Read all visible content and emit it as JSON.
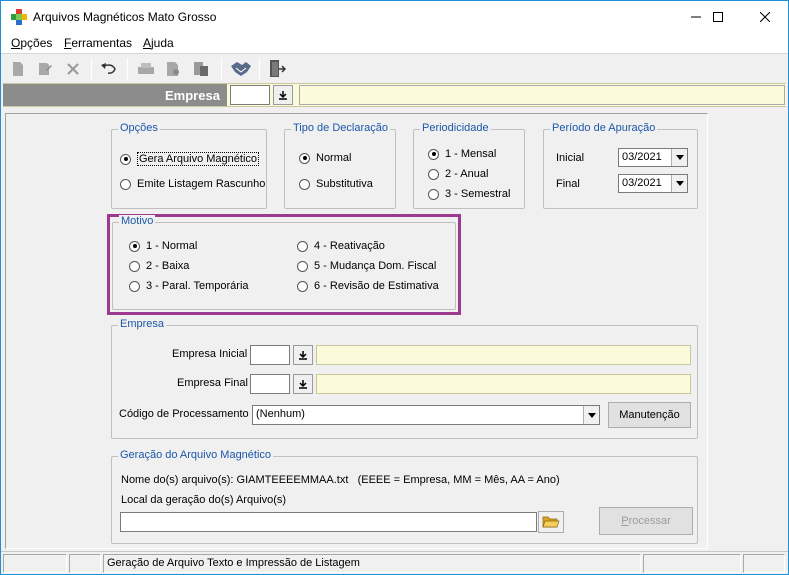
{
  "window": {
    "title": "Arquivos Magnéticos Mato Grosso",
    "controls": {
      "minimize": "–",
      "maximize": "☐",
      "close": "✕"
    }
  },
  "menu": {
    "items": [
      {
        "first": "O",
        "rest": "pções"
      },
      {
        "first": "F",
        "rest": "erramentas"
      },
      {
        "first": "A",
        "rest": "juda"
      }
    ]
  },
  "toolbar": {
    "icons": [
      "new-document-icon",
      "edit-document-icon",
      "delete-icon",
      "undo-icon",
      "print-icon",
      "print-preview-icon",
      "database-icon",
      "handshake-icon",
      "exit-door-icon"
    ]
  },
  "empresa_bar": {
    "label": "Empresa",
    "code_value": "",
    "name_value": ""
  },
  "opcoes": {
    "legend": "Opções",
    "options": [
      {
        "label": "Gera Arquivo Magnético",
        "selected": true
      },
      {
        "label": "Emite Listagem Rascunho",
        "selected": false
      }
    ]
  },
  "tipo_declaracao": {
    "legend": "Tipo de Declaração",
    "options": [
      {
        "label": "Normal",
        "selected": true
      },
      {
        "label": "Substitutiva",
        "selected": false
      }
    ]
  },
  "periodicidade": {
    "legend": "Periodicidade",
    "options": [
      {
        "label": "1 - Mensal",
        "selected": true
      },
      {
        "label": "2 - Anual",
        "selected": false
      },
      {
        "label": "3 - Semestral",
        "selected": false
      }
    ]
  },
  "periodo_apuracao": {
    "legend": "Período de Apuração",
    "inicial_label": "Inicial",
    "inicial_value": "03/2021",
    "final_label": "Final",
    "final_value": "03/2021"
  },
  "motivo": {
    "legend": "Motivo",
    "options": [
      {
        "label": "1 - Normal",
        "selected": true
      },
      {
        "label": "2 - Baixa",
        "selected": false
      },
      {
        "label": "3 - Paral. Temporária",
        "selected": false
      },
      {
        "label": "4 - Reativação",
        "selected": false
      },
      {
        "label": "5 - Mudança Dom. Fiscal",
        "selected": false
      },
      {
        "label": "6 - Revisão de Estimativa",
        "selected": false
      }
    ],
    "highlight_color": "#9b3a8e"
  },
  "empresa": {
    "legend": "Empresa",
    "inicial_label": "Empresa Inicial",
    "final_label": "Empresa Final",
    "codigo_label": "Código de Processamento",
    "codigo_value": "(Nenhum)",
    "manutencao_label": "Manutenção"
  },
  "geracao": {
    "legend": "Geração do Arquivo Magnético",
    "nome_text": "Nome do(s) arquivo(s): GIAMTEEEEMMAA.txt",
    "nome_hint": "(EEEE = Empresa, MM = Mês, AA = Ano)",
    "local_label": "Local da geração do(s) Arquivo(s)",
    "local_value": "",
    "processar_first": "P",
    "processar_rest": "rocessar"
  },
  "status": {
    "text": "Geração de Arquivo Texto e Impressão de Listagem"
  },
  "colors": {
    "accent": "#1c57a8",
    "yellow_field": "#fbfbd9",
    "highlight": "#9b3a8e"
  }
}
